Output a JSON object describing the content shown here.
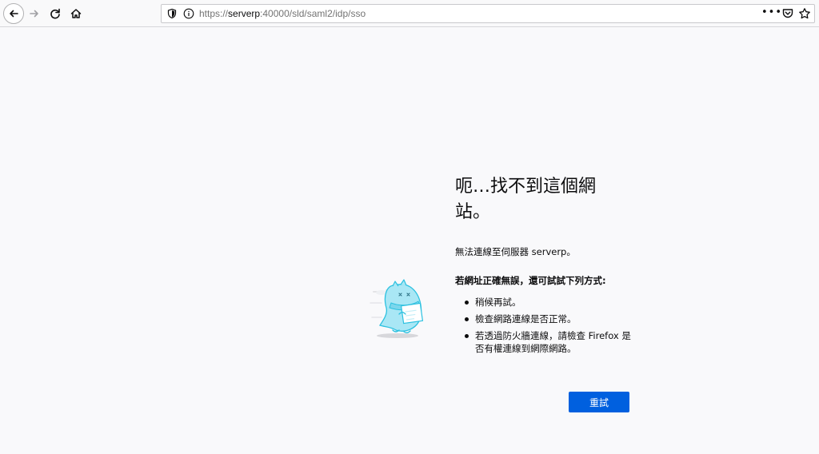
{
  "toolbar": {
    "icons": {
      "back": "back-arrow-icon",
      "forward": "forward-arrow-icon",
      "reload": "reload-icon",
      "home": "home-icon"
    }
  },
  "urlbar": {
    "scheme": "https://",
    "host": "serverp",
    "rest": ":40000/sld/saml2/idp/sso",
    "more_label": "•••"
  },
  "error": {
    "title": "呃…找不到這個網站。",
    "description": "無法連線至伺服器 serverp。",
    "suggestions_title": "若網址正確無誤，還可試試下列方式:",
    "suggestions": [
      "稍候再試。",
      "檢查網路連線是否正常。",
      "若透過防火牆連線，請檢查 Firefox 是否有權連線到網際網路。"
    ],
    "retry_label": "重試"
  },
  "colors": {
    "accent": "#0060df",
    "page_bg": "#f9f9fb"
  }
}
